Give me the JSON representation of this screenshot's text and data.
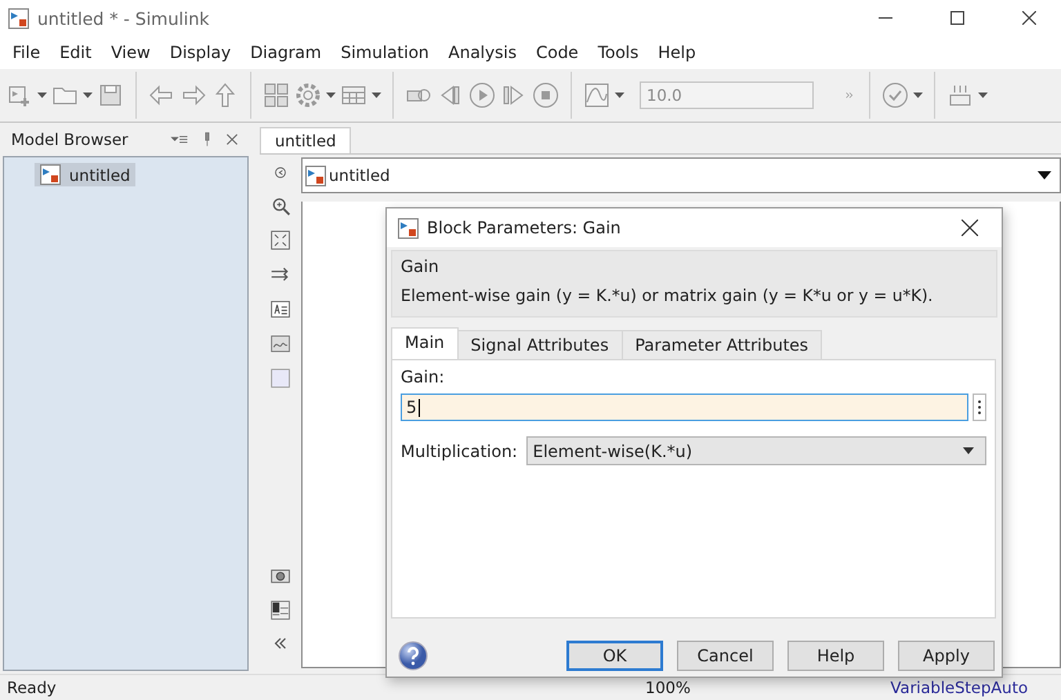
{
  "window": {
    "title": "untitled * - Simulink"
  },
  "menu": [
    "File",
    "Edit",
    "View",
    "Display",
    "Diagram",
    "Simulation",
    "Analysis",
    "Code",
    "Tools",
    "Help"
  ],
  "toolbar": {
    "stop_time": "10.0"
  },
  "model_browser": {
    "title": "Model Browser",
    "items": [
      {
        "label": "untitled",
        "selected": true
      }
    ]
  },
  "editor_tabs": [
    {
      "label": "untitled",
      "selected": true
    }
  ],
  "breadcrumb": "untitled",
  "dialog": {
    "title": "Block Parameters: Gain",
    "group_title": "Gain",
    "description": "Element-wise gain (y = K.*u) or matrix gain (y = K*u or y = u*K).",
    "tabs": [
      {
        "label": "Main",
        "selected": true
      },
      {
        "label": "Signal Attributes",
        "selected": false
      },
      {
        "label": "Parameter Attributes",
        "selected": false
      }
    ],
    "gain_label": "Gain:",
    "gain_value": "5",
    "multiplication_label": "Multiplication:",
    "multiplication_value": "Element-wise(K.*u)",
    "buttons": [
      {
        "label": "OK",
        "default": true
      },
      {
        "label": "Cancel",
        "default": false
      },
      {
        "label": "Help",
        "default": false
      },
      {
        "label": "Apply",
        "default": false
      }
    ]
  },
  "status_bar": {
    "state": "Ready",
    "zoom": "100%",
    "solver": "VariableStepAuto"
  }
}
